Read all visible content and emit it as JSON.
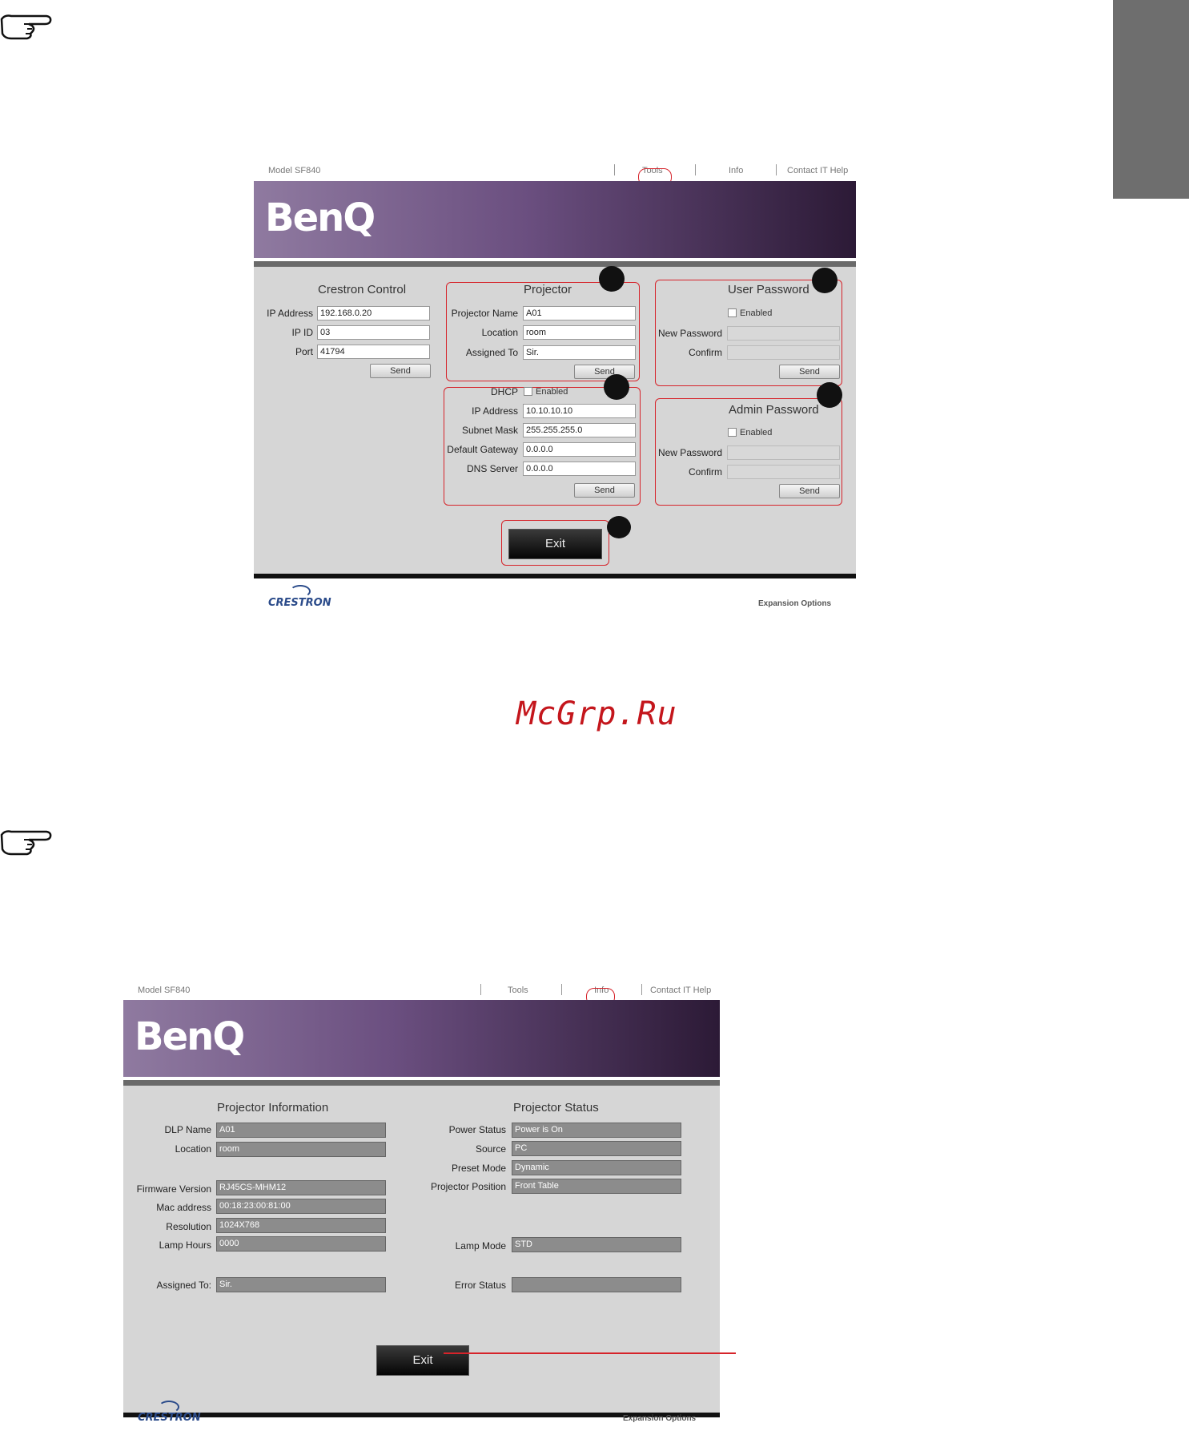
{
  "watermark": "McGrp.Ru",
  "icons": {
    "note_icon": "pointing-hand-icon"
  },
  "colors": {
    "accent_red": "#d6232a",
    "banner_dark": "#2c1a36",
    "banner_light": "#8f7aa0",
    "panel_bg": "#d6d6d6"
  },
  "tools_screen": {
    "model": "Model SF840",
    "nav": {
      "tools": "Tools",
      "info": "Info",
      "help": "Contact IT Help"
    },
    "logo": "BenQ",
    "crestron_control": {
      "title": "Crestron Control",
      "ip_label": "IP Address",
      "ip_value": "192.168.0.20",
      "ipid_label": "IP ID",
      "ipid_value": "03",
      "port_label": "Port",
      "port_value": "41794",
      "send": "Send"
    },
    "projector": {
      "title": "Projector",
      "name_label": "Projector Name",
      "name_value": "A01",
      "location_label": "Location",
      "location_value": "room",
      "assigned_label": "Assigned To",
      "assigned_value": "Sir.",
      "send": "Send"
    },
    "network": {
      "dhcp_label": "DHCP",
      "enabled_label": "Enabled",
      "ip_label": "IP Address",
      "ip_value": "10.10.10.10",
      "subnet_label": "Subnet Mask",
      "subnet_value": "255.255.255.0",
      "gateway_label": "Default Gateway",
      "gateway_value": "0.0.0.0",
      "dns_label": "DNS Server",
      "dns_value": "0.0.0.0",
      "send": "Send"
    },
    "user_password": {
      "title": "User Password",
      "enabled_label": "Enabled",
      "new_label": "New Password",
      "confirm_label": "Confirm",
      "send": "Send"
    },
    "admin_password": {
      "title": "Admin Password",
      "enabled_label": "Enabled",
      "new_label": "New Password",
      "confirm_label": "Confirm",
      "send": "Send"
    },
    "exit": "Exit",
    "crestron_logo": "CRESTRON",
    "expansion": "Expansion Options"
  },
  "info_screen": {
    "model": "Model SF840",
    "nav": {
      "tools": "Tools",
      "info": "Info",
      "help": "Contact IT Help"
    },
    "logo": "BenQ",
    "info_title": "Projector Information",
    "status_title": "Projector Status",
    "info_rows": [
      {
        "label": "DLP Name",
        "value": "A01"
      },
      {
        "label": "Location",
        "value": "room"
      },
      {
        "label": "Firmware Version",
        "value": "RJ45CS-MHM12"
      },
      {
        "label": "Mac address",
        "value": "00:18:23:00:81:00"
      },
      {
        "label": "Resolution",
        "value": "1024X768"
      },
      {
        "label": "Lamp Hours",
        "value": "0000"
      },
      {
        "label": "Assigned To:",
        "value": "Sir."
      }
    ],
    "status_rows": [
      {
        "label": "Power Status",
        "value": "Power is On"
      },
      {
        "label": "Source",
        "value": "PC"
      },
      {
        "label": "Preset Mode",
        "value": "Dynamic"
      },
      {
        "label": "Projector Position",
        "value": "Front Table"
      },
      {
        "label": "Lamp Mode",
        "value": "STD"
      },
      {
        "label": "Error Status",
        "value": ""
      }
    ],
    "exit": "Exit",
    "crestron_logo": "CRESTRON",
    "expansion": "Expansion Options"
  }
}
